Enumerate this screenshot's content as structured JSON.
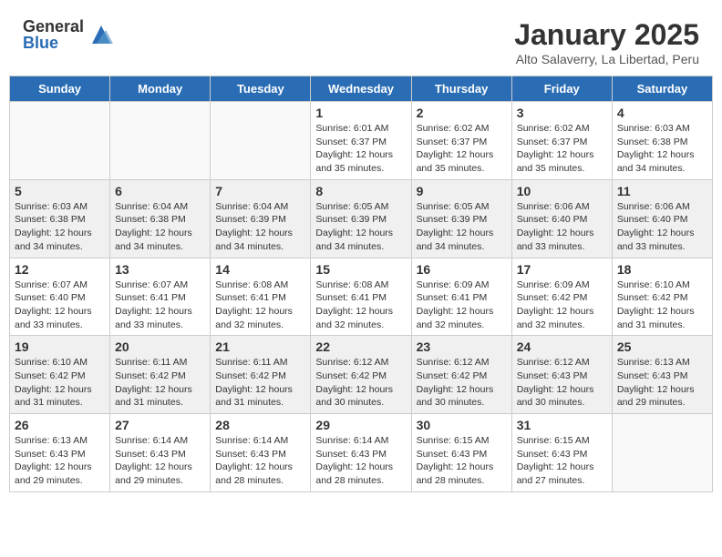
{
  "header": {
    "logo_general": "General",
    "logo_blue": "Blue",
    "month_title": "January 2025",
    "location": "Alto Salaverry, La Libertad, Peru"
  },
  "weekdays": [
    "Sunday",
    "Monday",
    "Tuesday",
    "Wednesday",
    "Thursday",
    "Friday",
    "Saturday"
  ],
  "weeks": [
    [
      {
        "day": "",
        "info": ""
      },
      {
        "day": "",
        "info": ""
      },
      {
        "day": "",
        "info": ""
      },
      {
        "day": "1",
        "info": "Sunrise: 6:01 AM\nSunset: 6:37 PM\nDaylight: 12 hours\nand 35 minutes."
      },
      {
        "day": "2",
        "info": "Sunrise: 6:02 AM\nSunset: 6:37 PM\nDaylight: 12 hours\nand 35 minutes."
      },
      {
        "day": "3",
        "info": "Sunrise: 6:02 AM\nSunset: 6:37 PM\nDaylight: 12 hours\nand 35 minutes."
      },
      {
        "day": "4",
        "info": "Sunrise: 6:03 AM\nSunset: 6:38 PM\nDaylight: 12 hours\nand 34 minutes."
      }
    ],
    [
      {
        "day": "5",
        "info": "Sunrise: 6:03 AM\nSunset: 6:38 PM\nDaylight: 12 hours\nand 34 minutes."
      },
      {
        "day": "6",
        "info": "Sunrise: 6:04 AM\nSunset: 6:38 PM\nDaylight: 12 hours\nand 34 minutes."
      },
      {
        "day": "7",
        "info": "Sunrise: 6:04 AM\nSunset: 6:39 PM\nDaylight: 12 hours\nand 34 minutes."
      },
      {
        "day": "8",
        "info": "Sunrise: 6:05 AM\nSunset: 6:39 PM\nDaylight: 12 hours\nand 34 minutes."
      },
      {
        "day": "9",
        "info": "Sunrise: 6:05 AM\nSunset: 6:39 PM\nDaylight: 12 hours\nand 34 minutes."
      },
      {
        "day": "10",
        "info": "Sunrise: 6:06 AM\nSunset: 6:40 PM\nDaylight: 12 hours\nand 33 minutes."
      },
      {
        "day": "11",
        "info": "Sunrise: 6:06 AM\nSunset: 6:40 PM\nDaylight: 12 hours\nand 33 minutes."
      }
    ],
    [
      {
        "day": "12",
        "info": "Sunrise: 6:07 AM\nSunset: 6:40 PM\nDaylight: 12 hours\nand 33 minutes."
      },
      {
        "day": "13",
        "info": "Sunrise: 6:07 AM\nSunset: 6:41 PM\nDaylight: 12 hours\nand 33 minutes."
      },
      {
        "day": "14",
        "info": "Sunrise: 6:08 AM\nSunset: 6:41 PM\nDaylight: 12 hours\nand 32 minutes."
      },
      {
        "day": "15",
        "info": "Sunrise: 6:08 AM\nSunset: 6:41 PM\nDaylight: 12 hours\nand 32 minutes."
      },
      {
        "day": "16",
        "info": "Sunrise: 6:09 AM\nSunset: 6:41 PM\nDaylight: 12 hours\nand 32 minutes."
      },
      {
        "day": "17",
        "info": "Sunrise: 6:09 AM\nSunset: 6:42 PM\nDaylight: 12 hours\nand 32 minutes."
      },
      {
        "day": "18",
        "info": "Sunrise: 6:10 AM\nSunset: 6:42 PM\nDaylight: 12 hours\nand 31 minutes."
      }
    ],
    [
      {
        "day": "19",
        "info": "Sunrise: 6:10 AM\nSunset: 6:42 PM\nDaylight: 12 hours\nand 31 minutes."
      },
      {
        "day": "20",
        "info": "Sunrise: 6:11 AM\nSunset: 6:42 PM\nDaylight: 12 hours\nand 31 minutes."
      },
      {
        "day": "21",
        "info": "Sunrise: 6:11 AM\nSunset: 6:42 PM\nDaylight: 12 hours\nand 31 minutes."
      },
      {
        "day": "22",
        "info": "Sunrise: 6:12 AM\nSunset: 6:42 PM\nDaylight: 12 hours\nand 30 minutes."
      },
      {
        "day": "23",
        "info": "Sunrise: 6:12 AM\nSunset: 6:42 PM\nDaylight: 12 hours\nand 30 minutes."
      },
      {
        "day": "24",
        "info": "Sunrise: 6:12 AM\nSunset: 6:43 PM\nDaylight: 12 hours\nand 30 minutes."
      },
      {
        "day": "25",
        "info": "Sunrise: 6:13 AM\nSunset: 6:43 PM\nDaylight: 12 hours\nand 29 minutes."
      }
    ],
    [
      {
        "day": "26",
        "info": "Sunrise: 6:13 AM\nSunset: 6:43 PM\nDaylight: 12 hours\nand 29 minutes."
      },
      {
        "day": "27",
        "info": "Sunrise: 6:14 AM\nSunset: 6:43 PM\nDaylight: 12 hours\nand 29 minutes."
      },
      {
        "day": "28",
        "info": "Sunrise: 6:14 AM\nSunset: 6:43 PM\nDaylight: 12 hours\nand 28 minutes."
      },
      {
        "day": "29",
        "info": "Sunrise: 6:14 AM\nSunset: 6:43 PM\nDaylight: 12 hours\nand 28 minutes."
      },
      {
        "day": "30",
        "info": "Sunrise: 6:15 AM\nSunset: 6:43 PM\nDaylight: 12 hours\nand 28 minutes."
      },
      {
        "day": "31",
        "info": "Sunrise: 6:15 AM\nSunset: 6:43 PM\nDaylight: 12 hours\nand 27 minutes."
      },
      {
        "day": "",
        "info": ""
      }
    ]
  ]
}
